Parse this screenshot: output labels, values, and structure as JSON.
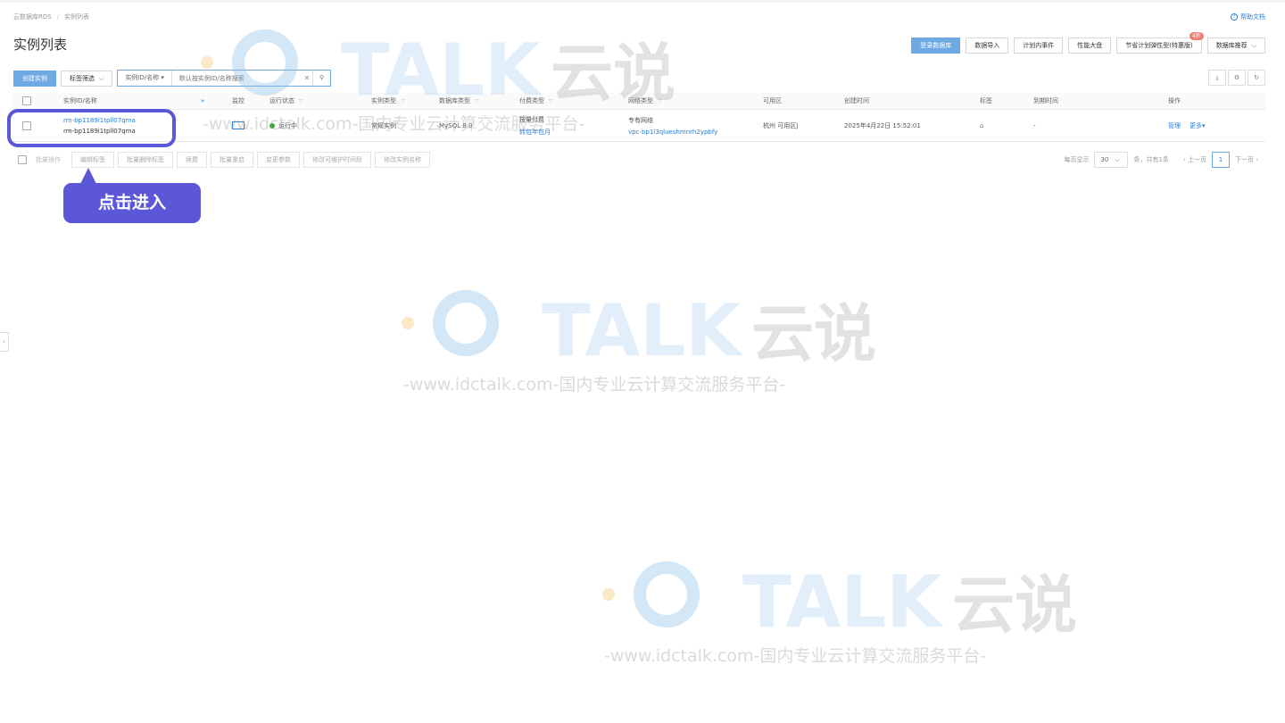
{
  "breadcrumb": [
    "云数据库RDS",
    "实例列表"
  ],
  "help_link": "帮助文档",
  "page_title": "实例列表",
  "top_actions": [
    {
      "label": "登录数据库",
      "primary": true
    },
    {
      "label": "数据导入"
    },
    {
      "label": "计划内事件"
    },
    {
      "label": "性能大盘"
    },
    {
      "label": "节省计划弹性型(特惠版)",
      "badge": "4折"
    },
    {
      "label": "数据库推荐",
      "caret": true
    }
  ],
  "toolbar": {
    "create_label": "创建实例",
    "tag_filter_label": "标签筛选",
    "search_scope": "实例ID/名称",
    "search_placeholder": "默认按实例ID/名称搜索",
    "clear": "✕",
    "go": "⚲"
  },
  "right_tools": [
    "⤓",
    "⚙",
    "↻"
  ],
  "table": {
    "headers": [
      "实例ID/名称",
      "监控",
      "运行状态",
      "实例类型",
      "数据库类型",
      "付费类型",
      "网络类型",
      "可用区",
      "创建时间",
      "标签",
      "到期时间",
      "操作"
    ],
    "rows": [
      {
        "instance_id": "rm-bp1189i1tpll07qma",
        "instance_name": "rm-bp1189i1tpll07qma",
        "status": "运行中",
        "instance_type": "常规实例",
        "db_type": "MySQL 8.0",
        "pay_type": "按量付费",
        "pay_action": "转包年包月",
        "network_type": "专有网络",
        "vpc": "vpc-bp1l3qlueshmnrh2ypbfy",
        "zone": "杭州 可用区J",
        "created": "2025年4月22日 15:52:01",
        "expire": "-",
        "op_manage": "管理",
        "op_more": "更多"
      }
    ]
  },
  "bulk": {
    "label": "批量操作",
    "buttons": [
      "编辑标签",
      "批量删除标签",
      "续费",
      "批量重启",
      "变更参数",
      "修改可维护时间段",
      "修改实例名称"
    ]
  },
  "pager": {
    "per_page_label": "每页显示",
    "per_page": "30",
    "total": "条，共有1条",
    "prev": "上一页",
    "current": "1",
    "next": "下一页"
  },
  "callout": "点击进入",
  "watermark": {
    "brand": "TALK 云说",
    "url": "-www.idctalk.com-国内专业云计算交流服务平台-"
  },
  "colors": {
    "primary": "#6fa9e3",
    "link": "#2a7ed8",
    "highlight": "#5b57d6",
    "running": "#3aaa35",
    "badge": "#f07c6f"
  }
}
